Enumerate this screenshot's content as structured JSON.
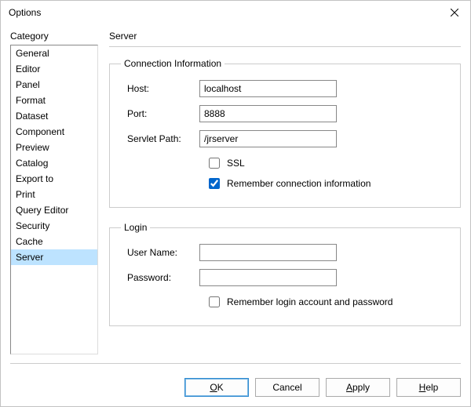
{
  "window": {
    "title": "Options"
  },
  "sidebar": {
    "heading": "Category",
    "items": [
      {
        "label": "General"
      },
      {
        "label": "Editor"
      },
      {
        "label": "Panel"
      },
      {
        "label": "Format"
      },
      {
        "label": "Dataset"
      },
      {
        "label": "Component"
      },
      {
        "label": "Preview"
      },
      {
        "label": "Catalog"
      },
      {
        "label": "Export to"
      },
      {
        "label": "Print"
      },
      {
        "label": "Query Editor"
      },
      {
        "label": "Security"
      },
      {
        "label": "Cache"
      },
      {
        "label": "Server"
      }
    ],
    "selected_index": 13
  },
  "page": {
    "title": "Server",
    "connection": {
      "legend": "Connection Information",
      "host_label": "Host:",
      "host_value": "localhost",
      "port_label": "Port:",
      "port_value": "8888",
      "servlet_label": "Servlet Path:",
      "servlet_value": "/jrserver",
      "ssl_label": "SSL",
      "ssl_checked": false,
      "remember_label": "Remember connection information",
      "remember_checked": true
    },
    "login": {
      "legend": "Login",
      "user_label": "User Name:",
      "user_value": "",
      "pass_label": "Password:",
      "pass_value": "",
      "remember_label": "Remember login account and password",
      "remember_checked": false
    }
  },
  "buttons": {
    "ok": "OK",
    "cancel": "Cancel",
    "apply": "Apply",
    "help": "Help"
  }
}
